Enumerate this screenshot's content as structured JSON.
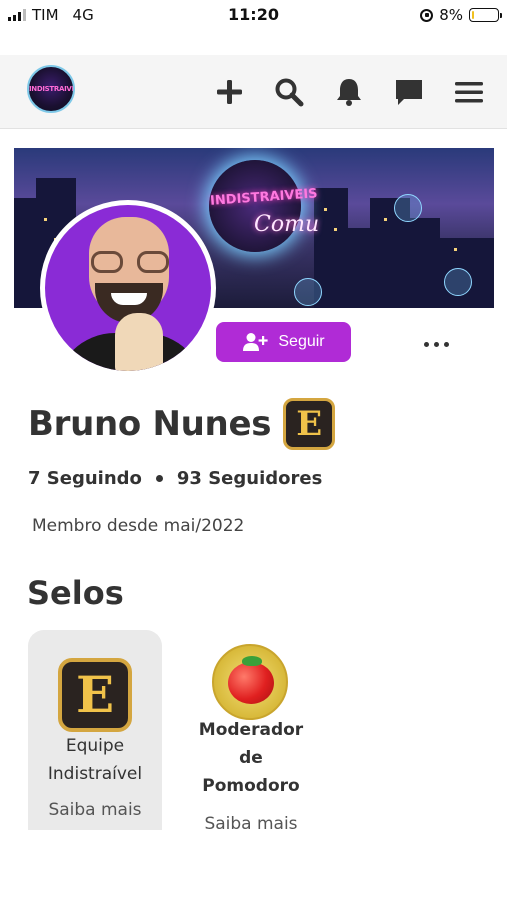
{
  "status_bar": {
    "carrier": "TIM",
    "network": "4G",
    "time": "11:20",
    "battery": "8%",
    "battery_level": 0.08
  },
  "navbar": {
    "logo_text": "INDISTRAIVEIS",
    "icons": [
      "plus-icon",
      "search-icon",
      "bell-icon",
      "chat-icon",
      "menu-icon"
    ]
  },
  "banner": {
    "title": "INDISTRAIVEIS",
    "subtitle": "Comu"
  },
  "profile": {
    "follow_label": "Seguir",
    "name": "Bruno Nunes",
    "badge_letter": "E",
    "following": "7 Seguindo",
    "followers": "93 Seguidores",
    "member_since": "Membro desde mai/2022"
  },
  "selos": {
    "title": "Selos",
    "items": [
      {
        "icon_letter": "E",
        "name_line1": "Equipe",
        "name_line2": "Indistraível",
        "link": "Saiba mais"
      },
      {
        "icon": "tomato-icon",
        "name_line1": "Moderador",
        "name_line2": "de",
        "name_line3": "Pomodoro",
        "link": "Saiba mais"
      }
    ]
  },
  "colors": {
    "accent": "#b02bd6",
    "gold": "#d4a640"
  }
}
